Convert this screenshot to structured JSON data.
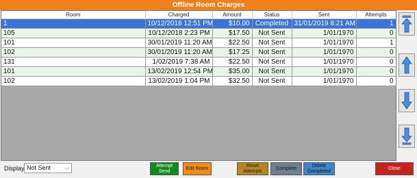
{
  "window": {
    "title": "Offline Room Charges"
  },
  "table": {
    "columns": [
      "Room",
      "Charged",
      "Amount",
      "Status",
      "Sent",
      "Attempts"
    ],
    "rows": [
      [
        "1",
        "10/12/2018 12:51 PM",
        "$10.00",
        "Completed",
        "31/01/2019 8:21 AM",
        "1"
      ],
      [
        "105",
        "10/12/2018 2:23 PM",
        "$17.50",
        "Not Sent",
        "1/01/1970",
        "0"
      ],
      [
        "101",
        "30/01/2019 11:20 AM",
        "$22.50",
        "Not Sent",
        "1/01/1970",
        "1"
      ],
      [
        "102",
        "30/01/2019 11:20 AM",
        "$17.25",
        "Not Sent",
        "1/01/1970",
        "0"
      ],
      [
        "131",
        "1/02/2019 7:38 AM",
        "$22.50",
        "Not Sent",
        "1/01/1970",
        "0"
      ],
      [
        "101",
        "13/02/2019 12:54 PM",
        "$35.00",
        "Not Sent",
        "1/01/1970",
        "0"
      ],
      [
        "102",
        "13/02/2019 1:04 PM",
        "$32.50",
        "Not Sent",
        "1/01/1970",
        "0"
      ]
    ],
    "selected_row": 0
  },
  "side_buttons": [
    {
      "icon": "arrow-top-icon"
    },
    {
      "icon": "arrow-up-icon"
    },
    {
      "icon": "arrow-down-icon"
    },
    {
      "icon": "arrow-bottom-icon"
    }
  ],
  "bottom": {
    "display_label": "Display",
    "display_value": "Not Sent",
    "buttons": {
      "attempt_send": "Attempt Send",
      "edit_room": "Edit Room",
      "reset_attempts": "Reset Attempts",
      "complete": "Complete",
      "delete_completed": "Delete Completed",
      "close": "Close"
    }
  },
  "colors": {
    "title_bar": "#f07f1c",
    "selected_row": "#3a74d4",
    "attempt_send": "#0f8a1e",
    "edit_room": "#f28a1a",
    "reset_attempts": "#b8861f",
    "complete": "#6f7f8f",
    "delete_completed": "#3c86c8",
    "close": "#c62222"
  }
}
